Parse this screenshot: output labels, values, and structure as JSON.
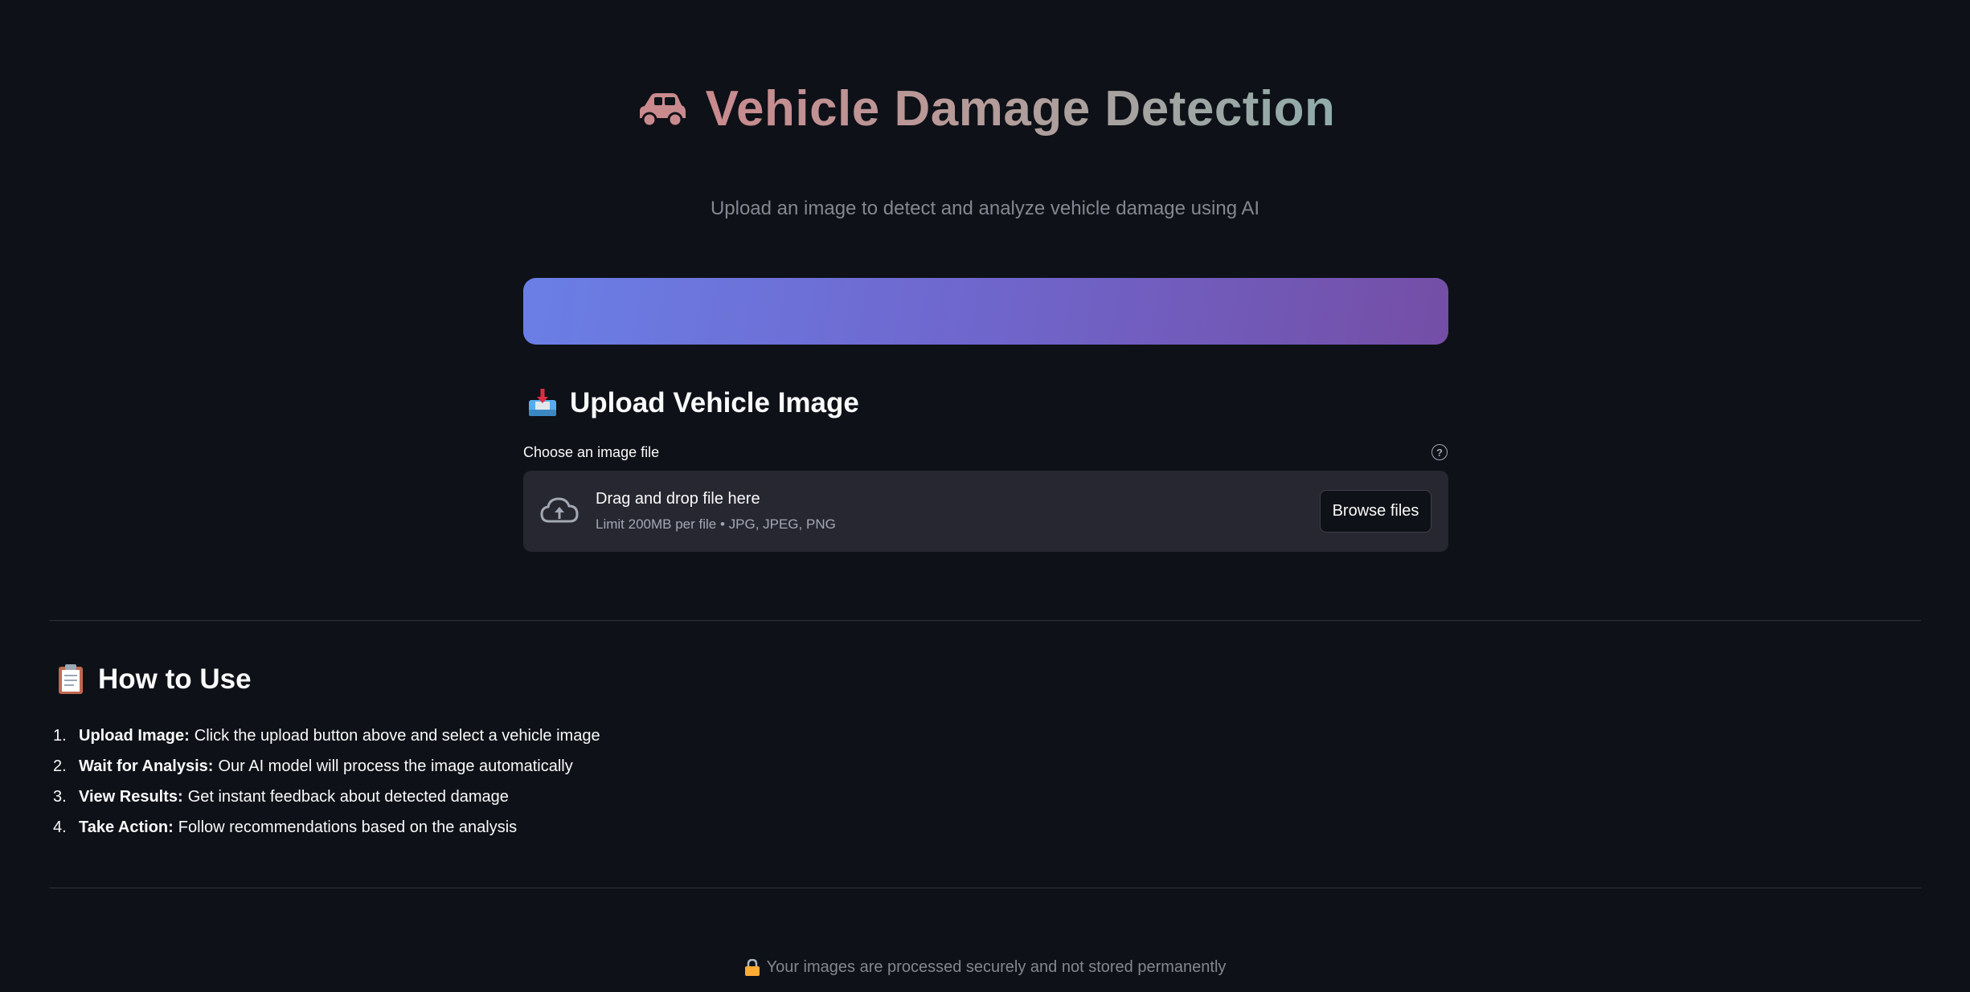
{
  "header": {
    "title": "Vehicle Damage Detection",
    "title_icon": "car-icon",
    "subtitle": "Upload an image to detect and analyze vehicle damage using AI"
  },
  "colors": {
    "background": "#0e1117",
    "banner_start": "#6a7fe6",
    "banner_end": "#744ea6",
    "dropzone": "#262730"
  },
  "upload": {
    "section_title": "Upload Vehicle Image",
    "section_icon": "inbox-tray-icon",
    "field_label": "Choose an image file",
    "help_icon": "question-circle-icon",
    "dropzone_title": "Drag and drop file here",
    "dropzone_limit": "Limit 200MB per file • JPG, JPEG, PNG",
    "browse_label": "Browse files"
  },
  "howto": {
    "section_title": "How to Use",
    "section_icon": "clipboard-icon",
    "steps": [
      {
        "num": "1.",
        "title": "Upload Image:",
        "text": "Click the upload button above and select a vehicle image"
      },
      {
        "num": "2.",
        "title": "Wait for Analysis:",
        "text": "Our AI model will process the image automatically"
      },
      {
        "num": "3.",
        "title": "View Results:",
        "text": "Get instant feedback about detected damage"
      },
      {
        "num": "4.",
        "title": "Take Action:",
        "text": "Follow recommendations based on the analysis"
      }
    ]
  },
  "footer": {
    "icon": "lock-icon",
    "text": "Your images are processed securely and not stored permanently"
  }
}
